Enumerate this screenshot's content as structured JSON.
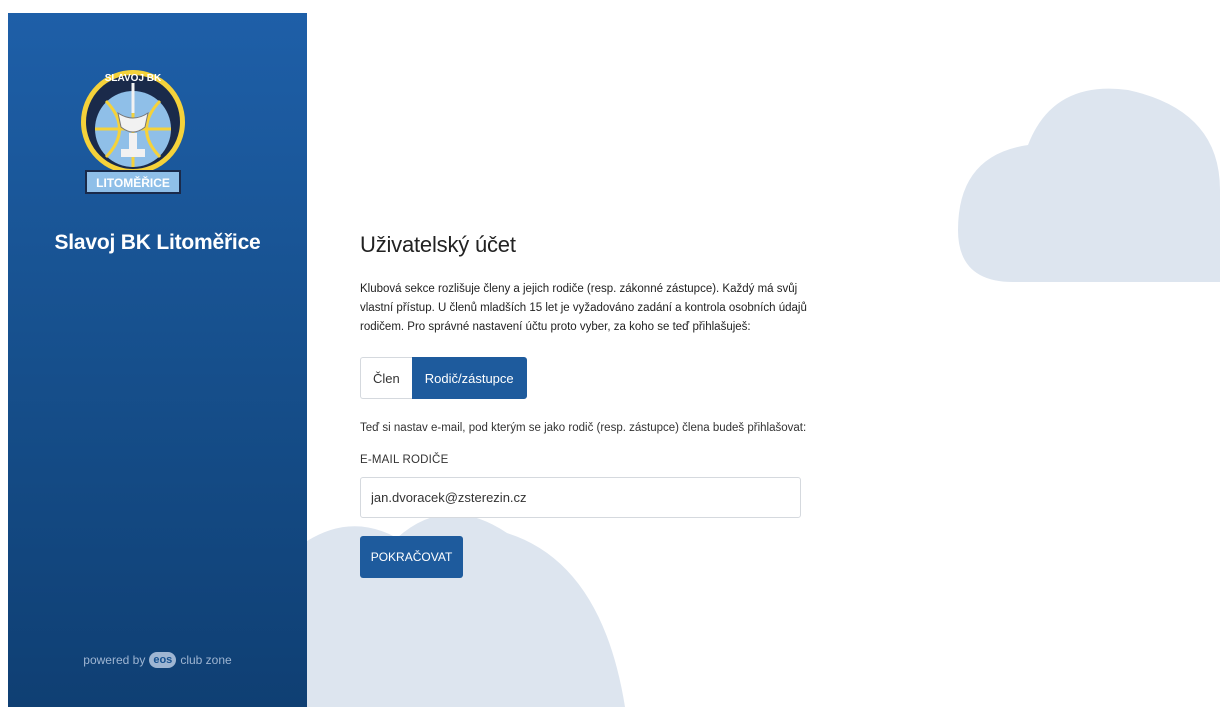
{
  "sidebar": {
    "club_name": "Slavoj BK Litoměřice",
    "logo": {
      "icon": "club-logo-icon",
      "text_top": "SLAVOJ BK",
      "text_bottom": "LITOMĚŘICE"
    },
    "powered_by": {
      "prefix": "powered by",
      "badge": "eos",
      "suffix": "club zone"
    }
  },
  "main": {
    "title": "Uživatelský účet",
    "intro": "Klubová sekce rozlišuje členy a jejich rodiče (resp. zákonné zástupce). Každý má svůj vlastní přístup. U členů mladších 15 let je vyžadováno zadání a kontrola osobních údajů rodičem. Pro správné nastavení účtu proto vyber, za koho se teď přihlašuješ:",
    "role_toggle": {
      "options": [
        "Člen",
        "Rodič/zástupce"
      ],
      "selected": "Rodič/zástupce"
    },
    "hint": "Teď si nastav e-mail, pod kterým se jako rodič (resp. zástupce) člena budeš přihlašovat:",
    "email_label": "E-MAIL RODIČE",
    "email_value": "jan.dvoracek@zsterezin.cz",
    "continue_label": "POKRAČOVAT"
  },
  "colors": {
    "sidebar": "#1b5a9e",
    "primary_button": "#1e5b9d",
    "cloud": "#dde5ef",
    "logo_yellow": "#f5d23a",
    "logo_blue": "#8fbfe8"
  }
}
